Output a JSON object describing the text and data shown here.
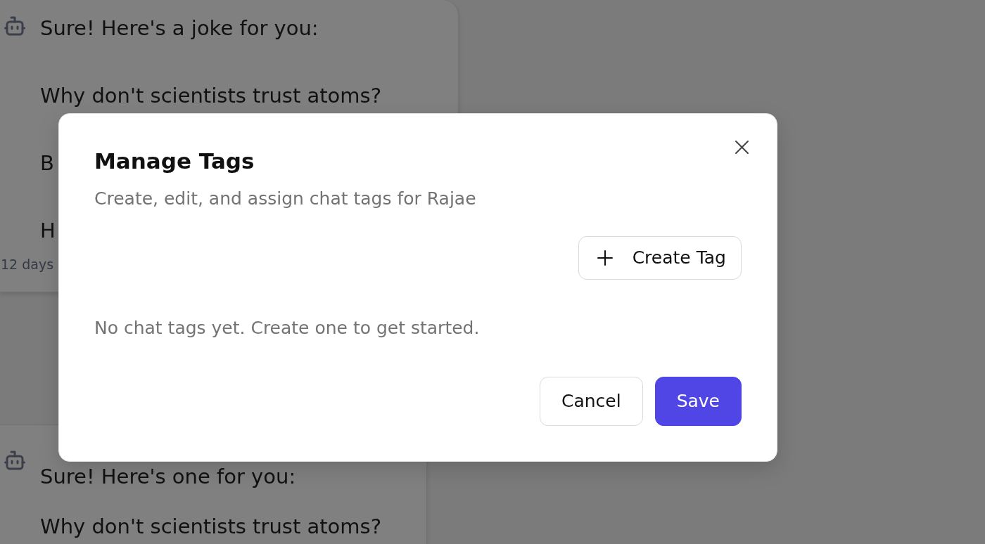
{
  "messages": [
    {
      "paragraphs": [
        "Sure! Here's a joke for you:",
        "Why don't scientists trust atoms?",
        "B",
        "H"
      ],
      "time": "12 days"
    },
    {
      "paragraphs": [
        "Sure! Here's one for you:",
        "Why don't scientists trust atoms?"
      ]
    }
  ],
  "dialog": {
    "title": "Manage Tags",
    "subtitle": "Create, edit, and assign chat tags for Rajae",
    "create_button": "Create Tag",
    "empty_message": "No chat tags yet. Create one to get started.",
    "buttons": [
      {
        "label": "Cancel",
        "kind": "secondary"
      },
      {
        "label": "Save",
        "kind": "primary"
      }
    ]
  }
}
